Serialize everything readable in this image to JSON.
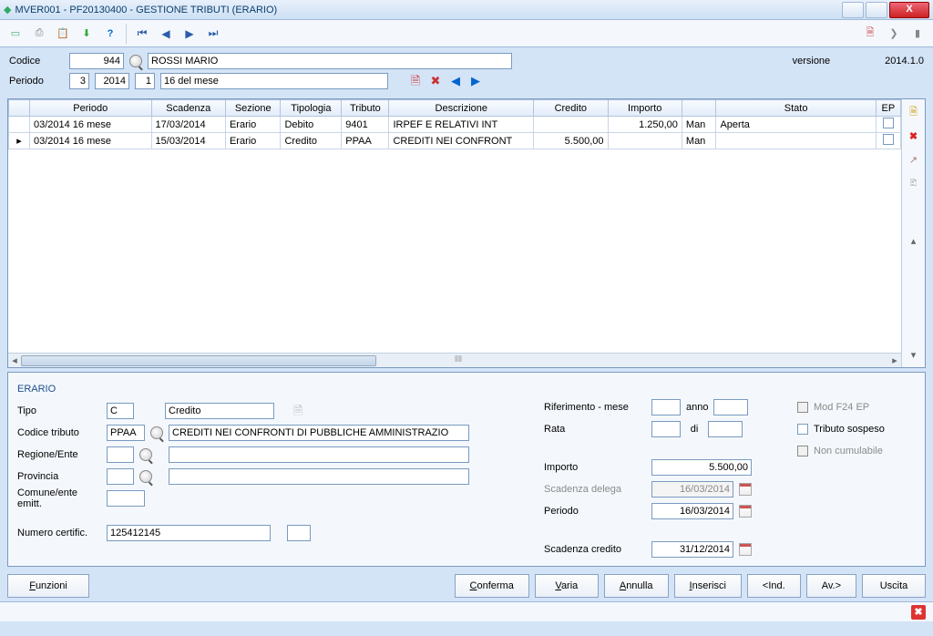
{
  "window": {
    "title": "MVER001  -  PF20130400 -   GESTIONE TRIBUTI (ERARIO)"
  },
  "header": {
    "codice_label": "Codice",
    "codice_value": "944",
    "nome": "ROSSI MARIO",
    "versione_label": "versione",
    "versione_value": "2014.1.0",
    "periodo_label": "Periodo",
    "periodo_m": "3",
    "periodo_y": "2014",
    "periodo_n": "1",
    "periodo_desc": "16 del mese"
  },
  "grid": {
    "cols": [
      "Periodo",
      "Scadenza",
      "Sezione",
      "Tipologia",
      "Tributo",
      "Descrizione",
      "Credito",
      "Importo",
      "",
      "Stato",
      "EP"
    ],
    "rows": [
      {
        "periodo": "03/2014 16 mese",
        "scadenza": "17/03/2014",
        "sezione": "Erario",
        "tipologia": "Debito",
        "tributo": "9401",
        "descrizione": "IRPEF E RELATIVI INT",
        "credito": "",
        "importo": "1.250,00",
        "man": "Man",
        "stato": "Aperta",
        "ep": false
      },
      {
        "periodo": "03/2014 16 mese",
        "scadenza": "15/03/2014",
        "sezione": "Erario",
        "tipologia": "Credito",
        "tributo": "PPAA",
        "descrizione": "CREDITI NEI CONFRONT",
        "credito": "5.500,00",
        "importo": "",
        "man": "Man",
        "stato": "",
        "ep": false
      }
    ]
  },
  "detail": {
    "section_title": "ERARIO",
    "tipo_label": "Tipo",
    "tipo_code": "C",
    "tipo_desc": "Credito",
    "codtrib_label": "Codice tributo",
    "codtrib_code": "PPAA",
    "codtrib_desc": "CREDITI NEI CONFRONTI DI PUBBLICHE AMMINISTRAZIO",
    "regione_label": "Regione/Ente",
    "provincia_label": "Provincia",
    "comune_label": "Comune/ente emitt.",
    "numcert_label": "Numero certific.",
    "numcert_value": "125412145",
    "rif_label": "Riferimento - mese",
    "anno_label": "anno",
    "rata_label": "Rata",
    "di_label": "di",
    "importo_label": "Importo",
    "importo_value": "5.500,00",
    "scaddel_label": "Scadenza delega",
    "scaddel_value": "16/03/2014",
    "periodo_label": "Periodo",
    "periodo_value": "16/03/2014",
    "scadcred_label": "Scadenza credito",
    "scadcred_value": "31/12/2014",
    "mod_f24_label": "Mod F24 EP",
    "trib_sosp_label": "Tributo sospeso",
    "non_cum_label": "Non cumulabile"
  },
  "buttons": {
    "funzioni": "Funzioni",
    "conferma": "Conferma",
    "varia": "Varia",
    "annulla": "Annulla",
    "inserisci": "Inserisci",
    "ind": "<Ind.",
    "av": "Av.>",
    "uscita": "Uscita"
  }
}
